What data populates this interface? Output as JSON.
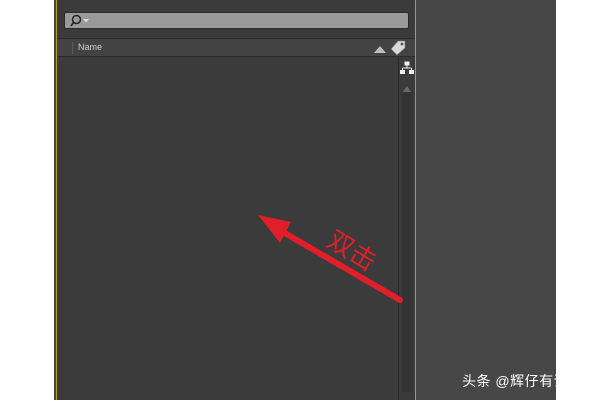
{
  "panel": {
    "search": {
      "value": "",
      "placeholder": ""
    },
    "columns": {
      "name": "Name"
    }
  },
  "annotation": {
    "text": "双击",
    "color": "#e01f2a"
  },
  "watermark": {
    "text": "头条 @辉仔有话说"
  },
  "colors": {
    "panel_bg": "#3b3b3b",
    "panel_border": "#b79b2f",
    "accent_red": "#e01f2a"
  },
  "icons": {
    "search": "magnifier-icon",
    "sort": "sort-ascending-icon",
    "tag": "tag-icon",
    "flow": "flowchart-icon",
    "scroll_up": "scroll-up-arrow-icon"
  }
}
